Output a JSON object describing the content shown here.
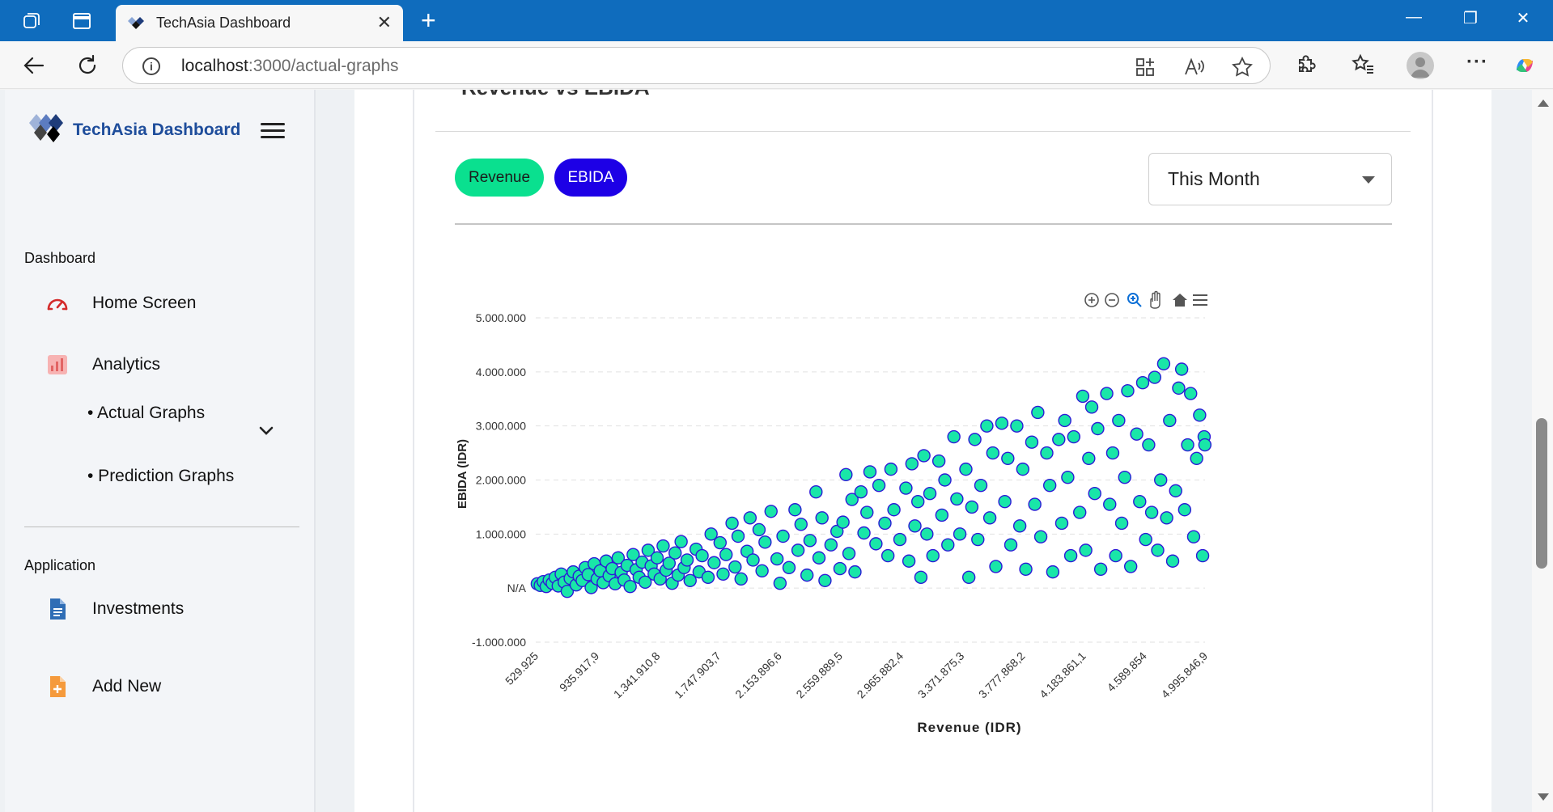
{
  "browser": {
    "tab_title": "TechAsia Dashboard",
    "tab_close": "✕",
    "new_tab": "+",
    "url_host": "localhost",
    "url_rest": ":3000/actual-graphs",
    "info_glyph": "i",
    "window_controls": [
      "—",
      "❐",
      "✕"
    ],
    "menu_glyph": "···"
  },
  "sidebar": {
    "brand": "TechAsia Dashboard",
    "sections": {
      "dashboard": "Dashboard",
      "application": "Application"
    },
    "items": [
      {
        "label": "Home Screen",
        "icon": "speedometer-icon"
      },
      {
        "label": "Analytics",
        "icon": "analytics-icon"
      },
      {
        "label": "Investments",
        "icon": "document-icon"
      },
      {
        "label": "Add New",
        "icon": "add-file-icon"
      }
    ],
    "sub_items": [
      "• Actual Graphs",
      "• Prediction Graphs"
    ]
  },
  "card": {
    "title": "Revenue vs EBIDA",
    "filters": {
      "revenue": "Revenue",
      "ebida": "EBIDA"
    },
    "period_select": "This Month"
  },
  "colors": {
    "titlebar": "#0f6cbd",
    "brand_text": "#1e4d9b",
    "revenue_pill": "#0ae08f",
    "ebida_pill": "#1d00e6",
    "point_fill": "#19e6a8",
    "point_stroke": "#2b1bd6"
  },
  "chart_data": {
    "type": "scatter",
    "xlabel": "Revenue (IDR)",
    "ylabel": "EBIDA (IDR)",
    "ylim": [
      -1000000,
      5000000
    ],
    "y_ticks": [
      {
        "value": 5000000,
        "label": "5.000.000"
      },
      {
        "value": 4000000,
        "label": "4.000.000"
      },
      {
        "value": 3000000,
        "label": "3.000.000"
      },
      {
        "value": 2000000,
        "label": "2.000.000"
      },
      {
        "value": 1000000,
        "label": "1.000.000"
      },
      {
        "value": 0,
        "label": "N/A"
      },
      {
        "value": -1000000,
        "label": "-1.000.000"
      }
    ],
    "xlim": [
      529925,
      4995846.9
    ],
    "x_ticks": [
      {
        "value": 529925,
        "label": "529.925"
      },
      {
        "value": 935917.9,
        "label": "935.917,9"
      },
      {
        "value": 1341910.8,
        "label": "1.341.910,8"
      },
      {
        "value": 1747903.7,
        "label": "1.747.903,7"
      },
      {
        "value": 2153896.6,
        "label": "2.153.896,6"
      },
      {
        "value": 2559889.5,
        "label": "2.559.889,5"
      },
      {
        "value": 2965882.4,
        "label": "2.965.882,4"
      },
      {
        "value": 3371875.3,
        "label": "3.371.875,3"
      },
      {
        "value": 3777868.2,
        "label": "3.777.868,2"
      },
      {
        "value": 4183861.1,
        "label": "4.183.861,1"
      },
      {
        "value": 4589854,
        "label": "4.589.854"
      },
      {
        "value": 4995846.9,
        "label": "4.995.846,9"
      }
    ],
    "grid": "horizontal-dashed",
    "toolbar": [
      "zoom-in-icon",
      "zoom-out-icon",
      "selection-zoom-icon",
      "pan-hand-icon",
      "reset-home-icon",
      "menu-icon"
    ],
    "series": [
      {
        "values_note": "",
        "points": [
          [
            540000,
            80000
          ],
          [
            560000,
            50000
          ],
          [
            580000,
            120000
          ],
          [
            600000,
            30000
          ],
          [
            620000,
            150000
          ],
          [
            640000,
            90000
          ],
          [
            660000,
            200000
          ],
          [
            680000,
            40000
          ],
          [
            700000,
            260000
          ],
          [
            720000,
            110000
          ],
          [
            740000,
            -60000
          ],
          [
            760000,
            180000
          ],
          [
            780000,
            300000
          ],
          [
            800000,
            60000
          ],
          [
            820000,
            220000
          ],
          [
            840000,
            140000
          ],
          [
            860000,
            380000
          ],
          [
            880000,
            250000
          ],
          [
            900000,
            10000
          ],
          [
            920000,
            450000
          ],
          [
            940000,
            170000
          ],
          [
            960000,
            320000
          ],
          [
            980000,
            100000
          ],
          [
            1000000,
            500000
          ],
          [
            1020000,
            230000
          ],
          [
            1040000,
            360000
          ],
          [
            1060000,
            80000
          ],
          [
            1080000,
            560000
          ],
          [
            1100000,
            290000
          ],
          [
            1120000,
            150000
          ],
          [
            1140000,
            420000
          ],
          [
            1160000,
            30000
          ],
          [
            1180000,
            620000
          ],
          [
            1200000,
            340000
          ],
          [
            1220000,
            200000
          ],
          [
            1240000,
            480000
          ],
          [
            1260000,
            110000
          ],
          [
            1280000,
            700000
          ],
          [
            1300000,
            410000
          ],
          [
            1320000,
            260000
          ],
          [
            1340000,
            560000
          ],
          [
            1360000,
            170000
          ],
          [
            1380000,
            780000
          ],
          [
            1400000,
            330000
          ],
          [
            1420000,
            460000
          ],
          [
            1440000,
            90000
          ],
          [
            1460000,
            650000
          ],
          [
            1480000,
            240000
          ],
          [
            1500000,
            860000
          ],
          [
            1520000,
            380000
          ],
          [
            1540000,
            520000
          ],
          [
            1560000,
            140000
          ],
          [
            1600000,
            720000
          ],
          [
            1620000,
            300000
          ],
          [
            1640000,
            600000
          ],
          [
            1680000,
            200000
          ],
          [
            1700000,
            1000000
          ],
          [
            1720000,
            470000
          ],
          [
            1760000,
            840000
          ],
          [
            1780000,
            260000
          ],
          [
            1800000,
            620000
          ],
          [
            1840000,
            1200000
          ],
          [
            1860000,
            390000
          ],
          [
            1880000,
            960000
          ],
          [
            1900000,
            170000
          ],
          [
            1940000,
            680000
          ],
          [
            1960000,
            1300000
          ],
          [
            1980000,
            520000
          ],
          [
            2020000,
            1080000
          ],
          [
            2040000,
            320000
          ],
          [
            2060000,
            850000
          ],
          [
            2100000,
            1420000
          ],
          [
            2140000,
            540000
          ],
          [
            2160000,
            90000
          ],
          [
            2180000,
            960000
          ],
          [
            2220000,
            380000
          ],
          [
            2260000,
            1450000
          ],
          [
            2280000,
            700000
          ],
          [
            2300000,
            1180000
          ],
          [
            2340000,
            240000
          ],
          [
            2360000,
            880000
          ],
          [
            2400000,
            1780000
          ],
          [
            2420000,
            560000
          ],
          [
            2440000,
            1300000
          ],
          [
            2460000,
            140000
          ],
          [
            2500000,
            800000
          ],
          [
            2540000,
            1050000
          ],
          [
            2560000,
            360000
          ],
          [
            2580000,
            1220000
          ],
          [
            2600000,
            2100000
          ],
          [
            2620000,
            640000
          ],
          [
            2640000,
            1640000
          ],
          [
            2660000,
            300000
          ],
          [
            2700000,
            1780000
          ],
          [
            2720000,
            1020000
          ],
          [
            2740000,
            1400000
          ],
          [
            2760000,
            2150000
          ],
          [
            2800000,
            820000
          ],
          [
            2820000,
            1900000
          ],
          [
            2860000,
            1200000
          ],
          [
            2880000,
            600000
          ],
          [
            2900000,
            2200000
          ],
          [
            2920000,
            1450000
          ],
          [
            2960000,
            900000
          ],
          [
            3000000,
            1850000
          ],
          [
            3020000,
            500000
          ],
          [
            3040000,
            2300000
          ],
          [
            3060000,
            1150000
          ],
          [
            3080000,
            1600000
          ],
          [
            3100000,
            200000
          ],
          [
            3120000,
            2450000
          ],
          [
            3140000,
            1000000
          ],
          [
            3160000,
            1750000
          ],
          [
            3180000,
            600000
          ],
          [
            3220000,
            2350000
          ],
          [
            3240000,
            1350000
          ],
          [
            3260000,
            2000000
          ],
          [
            3280000,
            800000
          ],
          [
            3320000,
            2800000
          ],
          [
            3340000,
            1650000
          ],
          [
            3360000,
            1000000
          ],
          [
            3400000,
            2200000
          ],
          [
            3420000,
            200000
          ],
          [
            3440000,
            1500000
          ],
          [
            3460000,
            2750000
          ],
          [
            3480000,
            900000
          ],
          [
            3500000,
            1900000
          ],
          [
            3540000,
            3000000
          ],
          [
            3560000,
            1300000
          ],
          [
            3580000,
            2500000
          ],
          [
            3600000,
            400000
          ],
          [
            3640000,
            3050000
          ],
          [
            3660000,
            1600000
          ],
          [
            3680000,
            2400000
          ],
          [
            3700000,
            800000
          ],
          [
            3740000,
            3000000
          ],
          [
            3760000,
            1150000
          ],
          [
            3780000,
            2200000
          ],
          [
            3800000,
            350000
          ],
          [
            3840000,
            2700000
          ],
          [
            3860000,
            1550000
          ],
          [
            3880000,
            3250000
          ],
          [
            3900000,
            950000
          ],
          [
            3940000,
            2500000
          ],
          [
            3960000,
            1900000
          ],
          [
            3980000,
            300000
          ],
          [
            4020000,
            2750000
          ],
          [
            4040000,
            1200000
          ],
          [
            4060000,
            3100000
          ],
          [
            4080000,
            2050000
          ],
          [
            4100000,
            600000
          ],
          [
            4120000,
            2800000
          ],
          [
            4160000,
            1400000
          ],
          [
            4180000,
            3550000
          ],
          [
            4200000,
            700000
          ],
          [
            4220000,
            2400000
          ],
          [
            4240000,
            3350000
          ],
          [
            4260000,
            1750000
          ],
          [
            4280000,
            2950000
          ],
          [
            4300000,
            350000
          ],
          [
            4340000,
            3600000
          ],
          [
            4360000,
            1550000
          ],
          [
            4380000,
            2500000
          ],
          [
            4400000,
            600000
          ],
          [
            4420000,
            3100000
          ],
          [
            4440000,
            1200000
          ],
          [
            4460000,
            2050000
          ],
          [
            4480000,
            3650000
          ],
          [
            4500000,
            400000
          ],
          [
            4540000,
            2850000
          ],
          [
            4560000,
            1600000
          ],
          [
            4580000,
            3800000
          ],
          [
            4600000,
            900000
          ],
          [
            4620000,
            2650000
          ],
          [
            4640000,
            1400000
          ],
          [
            4660000,
            3900000
          ],
          [
            4680000,
            700000
          ],
          [
            4700000,
            2000000
          ],
          [
            4720000,
            4150000
          ],
          [
            4740000,
            1300000
          ],
          [
            4760000,
            3100000
          ],
          [
            4780000,
            500000
          ],
          [
            4800000,
            1800000
          ],
          [
            4820000,
            3700000
          ],
          [
            4840000,
            4050000
          ],
          [
            4860000,
            1450000
          ],
          [
            4880000,
            2650000
          ],
          [
            4900000,
            3600000
          ],
          [
            4920000,
            950000
          ],
          [
            4940000,
            2400000
          ],
          [
            4960000,
            3200000
          ],
          [
            4980000,
            600000
          ],
          [
            4990000,
            2800000
          ],
          [
            4995000,
            2650000
          ]
        ]
      }
    ]
  }
}
